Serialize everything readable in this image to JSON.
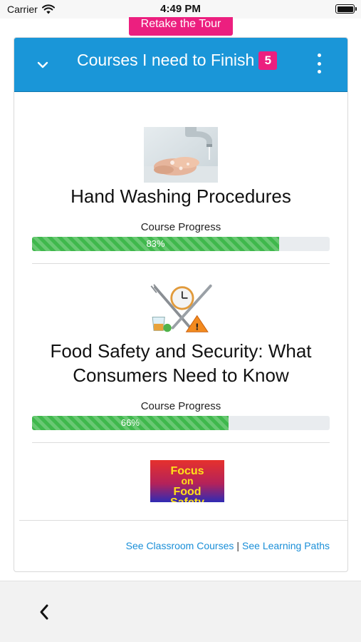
{
  "status_bar": {
    "carrier": "Carrier",
    "time": "4:49 PM"
  },
  "retake_tour": {
    "label": "Retake the Tour"
  },
  "card": {
    "title": "Courses I need to Finish",
    "count": "5",
    "header_color": "#1a96d8",
    "badge_color": "#ec1f7f"
  },
  "courses": [
    {
      "title": "Hand Washing Procedures",
      "progress_label": "Course Progress",
      "progress": 83,
      "progress_text": "83%",
      "thumbnail": "hand-washing-photo"
    },
    {
      "title": "Food Safety and Security: What Consumers Need to Know",
      "progress_label": "Course Progress",
      "progress": 66,
      "progress_text": "66%",
      "thumbnail": "utensils-clock-warning-illustration"
    },
    {
      "thumbnail": "focus-on-food-safety-poster",
      "thumbnail_text": [
        "Focus",
        "on",
        "Food",
        "Safety"
      ]
    }
  ],
  "footer": {
    "classroom_link": "See Classroom Courses",
    "separator": "|",
    "paths_link": "See Learning Paths",
    "link_color": "#1a8fd8"
  },
  "nav": {
    "back_icon": "chevron-left-icon"
  }
}
